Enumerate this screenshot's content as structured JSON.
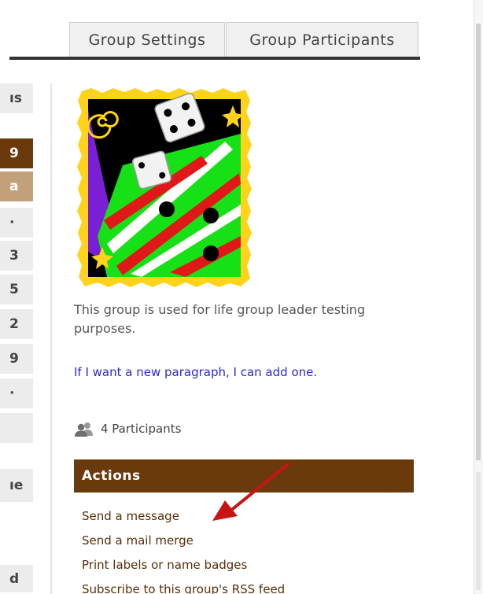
{
  "tabs": [
    {
      "label": "Group Settings"
    },
    {
      "label": "Group Participants"
    }
  ],
  "sidebar": {
    "items": [
      {
        "label": "ıs"
      },
      {
        "label": "9"
      },
      {
        "label": "a"
      },
      {
        "label": "·"
      },
      {
        "label": "3"
      },
      {
        "label": "5"
      },
      {
        "label": "2"
      },
      {
        "label": "9"
      },
      {
        "label": "·"
      },
      {
        "label": ""
      },
      {
        "label": "ıe"
      },
      {
        "label": "d"
      }
    ]
  },
  "group": {
    "description": "This group is used for life group leader testing purposes.",
    "link_text": "If I want a new paragraph, I can add one.",
    "participants_label": "4 Participants"
  },
  "actions": {
    "title": "Actions",
    "items": [
      {
        "label": "Send a message"
      },
      {
        "label": "Send a mail merge"
      },
      {
        "label": "Print labels or name badges"
      },
      {
        "label": "Subscribe to this group's RSS feed"
      }
    ]
  },
  "colors": {
    "brand_brown": "#6b3a0c",
    "tan": "#c2a07a",
    "link_blue": "#2a2ad0",
    "annotation_arrow": "#c81414"
  }
}
